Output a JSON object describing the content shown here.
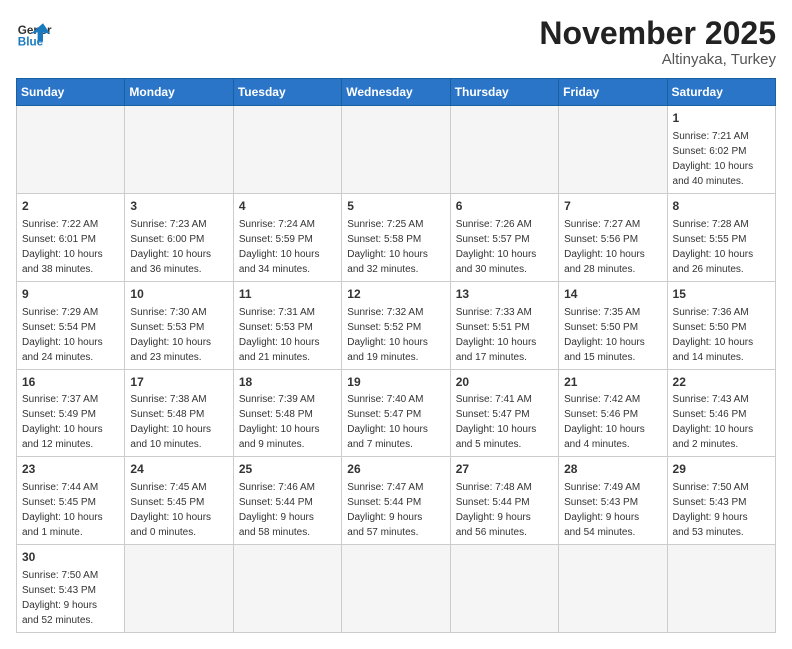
{
  "header": {
    "logo_general": "General",
    "logo_blue": "Blue",
    "month_title": "November 2025",
    "location": "Altinyaka, Turkey"
  },
  "weekdays": [
    "Sunday",
    "Monday",
    "Tuesday",
    "Wednesday",
    "Thursday",
    "Friday",
    "Saturday"
  ],
  "weeks": [
    [
      {
        "day": "",
        "info": ""
      },
      {
        "day": "",
        "info": ""
      },
      {
        "day": "",
        "info": ""
      },
      {
        "day": "",
        "info": ""
      },
      {
        "day": "",
        "info": ""
      },
      {
        "day": "",
        "info": ""
      },
      {
        "day": "1",
        "info": "Sunrise: 7:21 AM\nSunset: 6:02 PM\nDaylight: 10 hours\nand 40 minutes."
      }
    ],
    [
      {
        "day": "2",
        "info": "Sunrise: 7:22 AM\nSunset: 6:01 PM\nDaylight: 10 hours\nand 38 minutes."
      },
      {
        "day": "3",
        "info": "Sunrise: 7:23 AM\nSunset: 6:00 PM\nDaylight: 10 hours\nand 36 minutes."
      },
      {
        "day": "4",
        "info": "Sunrise: 7:24 AM\nSunset: 5:59 PM\nDaylight: 10 hours\nand 34 minutes."
      },
      {
        "day": "5",
        "info": "Sunrise: 7:25 AM\nSunset: 5:58 PM\nDaylight: 10 hours\nand 32 minutes."
      },
      {
        "day": "6",
        "info": "Sunrise: 7:26 AM\nSunset: 5:57 PM\nDaylight: 10 hours\nand 30 minutes."
      },
      {
        "day": "7",
        "info": "Sunrise: 7:27 AM\nSunset: 5:56 PM\nDaylight: 10 hours\nand 28 minutes."
      },
      {
        "day": "8",
        "info": "Sunrise: 7:28 AM\nSunset: 5:55 PM\nDaylight: 10 hours\nand 26 minutes."
      }
    ],
    [
      {
        "day": "9",
        "info": "Sunrise: 7:29 AM\nSunset: 5:54 PM\nDaylight: 10 hours\nand 24 minutes."
      },
      {
        "day": "10",
        "info": "Sunrise: 7:30 AM\nSunset: 5:53 PM\nDaylight: 10 hours\nand 23 minutes."
      },
      {
        "day": "11",
        "info": "Sunrise: 7:31 AM\nSunset: 5:53 PM\nDaylight: 10 hours\nand 21 minutes."
      },
      {
        "day": "12",
        "info": "Sunrise: 7:32 AM\nSunset: 5:52 PM\nDaylight: 10 hours\nand 19 minutes."
      },
      {
        "day": "13",
        "info": "Sunrise: 7:33 AM\nSunset: 5:51 PM\nDaylight: 10 hours\nand 17 minutes."
      },
      {
        "day": "14",
        "info": "Sunrise: 7:35 AM\nSunset: 5:50 PM\nDaylight: 10 hours\nand 15 minutes."
      },
      {
        "day": "15",
        "info": "Sunrise: 7:36 AM\nSunset: 5:50 PM\nDaylight: 10 hours\nand 14 minutes."
      }
    ],
    [
      {
        "day": "16",
        "info": "Sunrise: 7:37 AM\nSunset: 5:49 PM\nDaylight: 10 hours\nand 12 minutes."
      },
      {
        "day": "17",
        "info": "Sunrise: 7:38 AM\nSunset: 5:48 PM\nDaylight: 10 hours\nand 10 minutes."
      },
      {
        "day": "18",
        "info": "Sunrise: 7:39 AM\nSunset: 5:48 PM\nDaylight: 10 hours\nand 9 minutes."
      },
      {
        "day": "19",
        "info": "Sunrise: 7:40 AM\nSunset: 5:47 PM\nDaylight: 10 hours\nand 7 minutes."
      },
      {
        "day": "20",
        "info": "Sunrise: 7:41 AM\nSunset: 5:47 PM\nDaylight: 10 hours\nand 5 minutes."
      },
      {
        "day": "21",
        "info": "Sunrise: 7:42 AM\nSunset: 5:46 PM\nDaylight: 10 hours\nand 4 minutes."
      },
      {
        "day": "22",
        "info": "Sunrise: 7:43 AM\nSunset: 5:46 PM\nDaylight: 10 hours\nand 2 minutes."
      }
    ],
    [
      {
        "day": "23",
        "info": "Sunrise: 7:44 AM\nSunset: 5:45 PM\nDaylight: 10 hours\nand 1 minute."
      },
      {
        "day": "24",
        "info": "Sunrise: 7:45 AM\nSunset: 5:45 PM\nDaylight: 10 hours\nand 0 minutes."
      },
      {
        "day": "25",
        "info": "Sunrise: 7:46 AM\nSunset: 5:44 PM\nDaylight: 9 hours\nand 58 minutes."
      },
      {
        "day": "26",
        "info": "Sunrise: 7:47 AM\nSunset: 5:44 PM\nDaylight: 9 hours\nand 57 minutes."
      },
      {
        "day": "27",
        "info": "Sunrise: 7:48 AM\nSunset: 5:44 PM\nDaylight: 9 hours\nand 56 minutes."
      },
      {
        "day": "28",
        "info": "Sunrise: 7:49 AM\nSunset: 5:43 PM\nDaylight: 9 hours\nand 54 minutes."
      },
      {
        "day": "29",
        "info": "Sunrise: 7:50 AM\nSunset: 5:43 PM\nDaylight: 9 hours\nand 53 minutes."
      }
    ],
    [
      {
        "day": "30",
        "info": "Sunrise: 7:50 AM\nSunset: 5:43 PM\nDaylight: 9 hours\nand 52 minutes."
      },
      {
        "day": "",
        "info": ""
      },
      {
        "day": "",
        "info": ""
      },
      {
        "day": "",
        "info": ""
      },
      {
        "day": "",
        "info": ""
      },
      {
        "day": "",
        "info": ""
      },
      {
        "day": "",
        "info": ""
      }
    ]
  ]
}
